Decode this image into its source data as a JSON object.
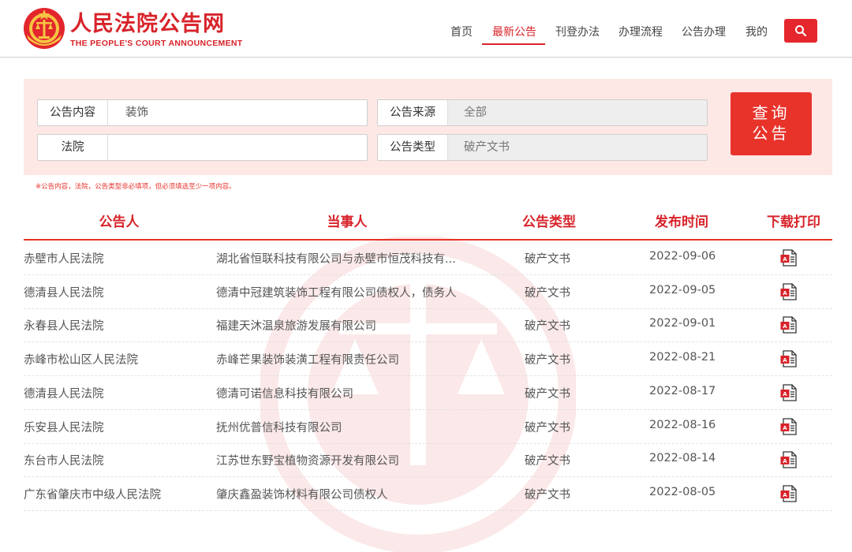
{
  "brand": {
    "title": "人民法院公告网",
    "subtitle": "THE PEOPLE'S COURT ANNOUNCEMENT"
  },
  "nav": {
    "items": [
      "首页",
      "最新公告",
      "刊登办法",
      "办理流程",
      "公告办理",
      "我的"
    ],
    "active_index": 1
  },
  "filters": {
    "content_label": "公告内容",
    "content_value": "装饰",
    "court_label": "法院",
    "court_value": "",
    "source_label": "公告来源",
    "source_value": "全部",
    "type_label": "公告类型",
    "type_value": "破产文书",
    "query_line1": "查询",
    "query_line2": "公告",
    "hint": "※公告内容，法院，公告类型非必填项，但必须填选至少一项内容。"
  },
  "table": {
    "headers": [
      "公告人",
      "当事人",
      "公告类型",
      "发布时间",
      "下载打印"
    ],
    "rows": [
      {
        "court": "赤壁市人民法院",
        "party": "湖北省恒联科技有限公司与赤壁市恒茂科技有...",
        "type": "破产文书",
        "date": "2022-09-06"
      },
      {
        "court": "德清县人民法院",
        "party": "德清中冠建筑装饰工程有限公司债权人，债务人",
        "type": "破产文书",
        "date": "2022-09-05"
      },
      {
        "court": "永春县人民法院",
        "party": "福建天沐温泉旅游发展有限公司",
        "type": "破产文书",
        "date": "2022-09-01"
      },
      {
        "court": "赤峰市松山区人民法院",
        "party": "赤峰芒果装饰装潢工程有限责任公司",
        "type": "破产文书",
        "date": "2022-08-21"
      },
      {
        "court": "德清县人民法院",
        "party": "德清可诺信息科技有限公司",
        "type": "破产文书",
        "date": "2022-08-17"
      },
      {
        "court": "乐安县人民法院",
        "party": "抚州优普信科技有限公司",
        "type": "破产文书",
        "date": "2022-08-16"
      },
      {
        "court": "东台市人民法院",
        "party": "江苏世东野宝植物资源开发有限公司",
        "type": "破产文书",
        "date": "2022-08-14"
      },
      {
        "court": "广东省肇庆市中级人民法院",
        "party": "肇庆鑫盈装饰材料有限公司债权人",
        "type": "破产文书",
        "date": "2022-08-05"
      }
    ]
  },
  "colors": {
    "accent": "#d8232a",
    "panel_bg": "#fde8e6"
  },
  "icons": [
    "court-emblem-icon",
    "search-icon",
    "pdf-icon"
  ]
}
